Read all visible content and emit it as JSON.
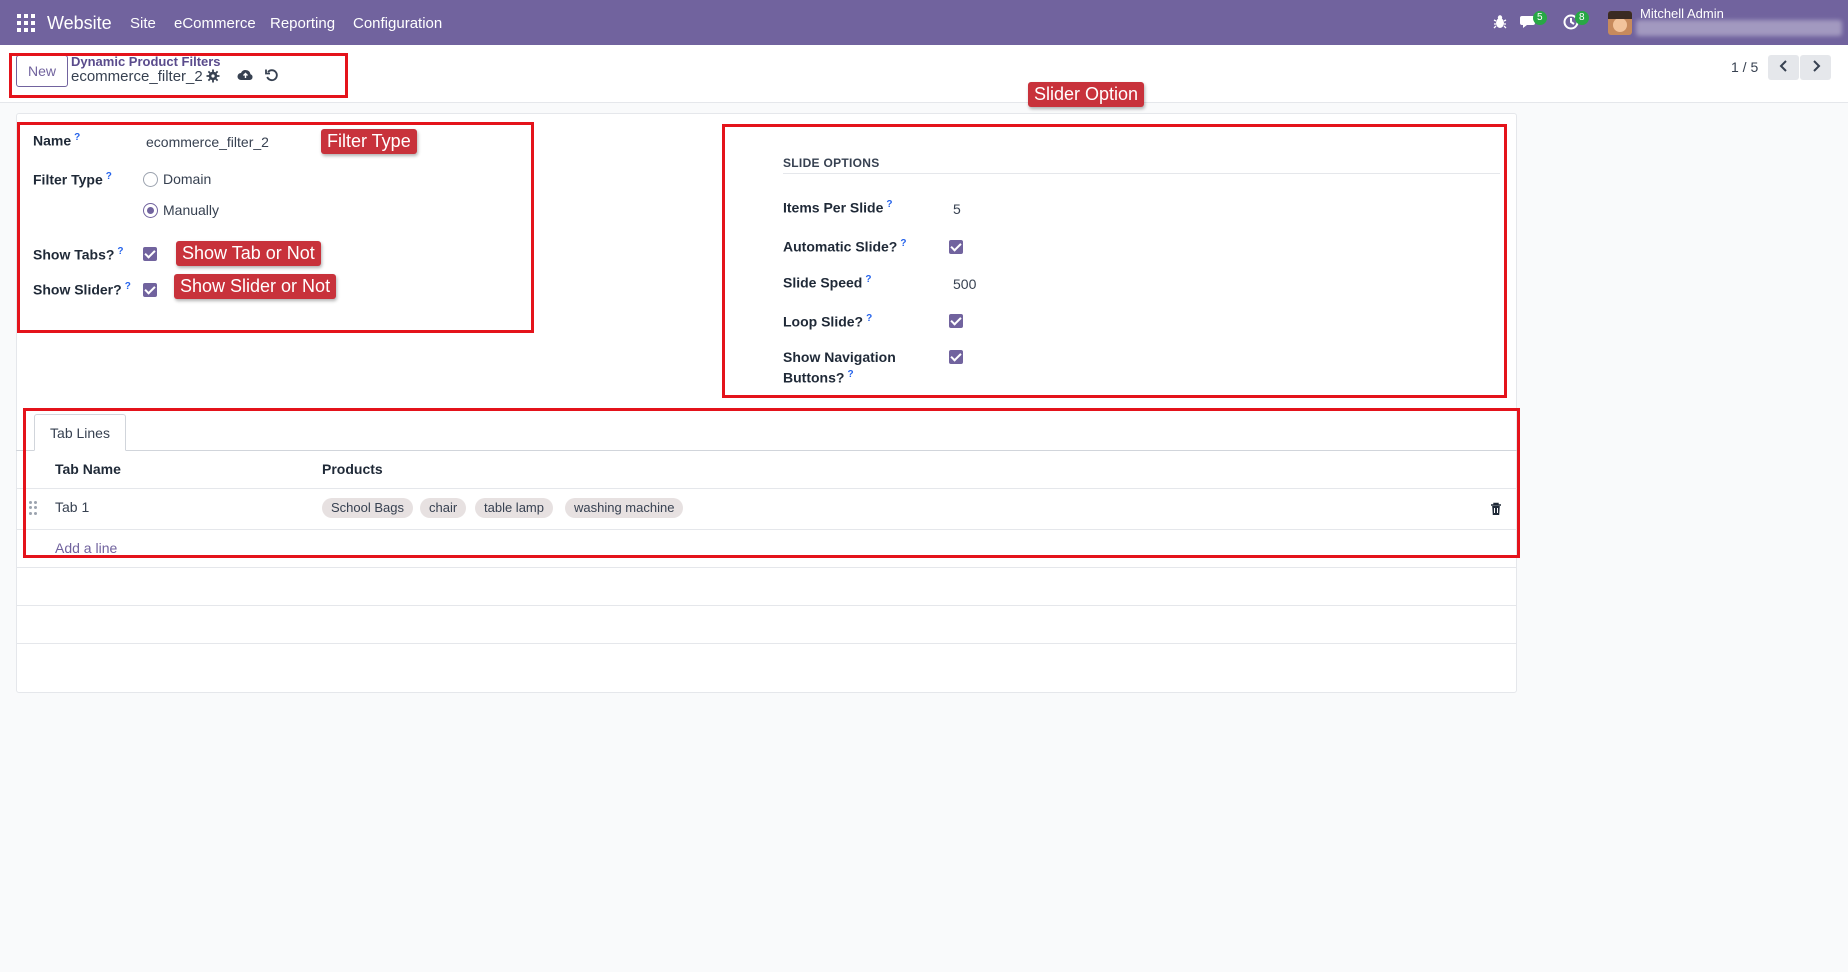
{
  "navbar": {
    "app_name": "Website",
    "menu": [
      "Site",
      "eCommerce",
      "Reporting",
      "Configuration"
    ],
    "messages_count": "5",
    "activities_count": "8",
    "user_name": "Mitchell Admin"
  },
  "control_panel": {
    "new_label": "New",
    "breadcrumb_parent": "Dynamic Product Filters",
    "breadcrumb_current": "ecommerce_filter_2",
    "pager": "1 / 5"
  },
  "form": {
    "name_label": "Name",
    "name_value": "ecommerce_filter_2",
    "filter_type_label": "Filter Type",
    "filter_type_options": [
      "Domain",
      "Manually"
    ],
    "filter_type_selected": "Manually",
    "show_tabs_label": "Show Tabs?",
    "show_tabs": true,
    "show_slider_label": "Show Slider?",
    "show_slider": true
  },
  "slide_options": {
    "title": "SLIDE OPTIONS",
    "items_per_slide_label": "Items Per Slide",
    "items_per_slide": "5",
    "automatic_slide_label": "Automatic Slide?",
    "automatic_slide": true,
    "slide_speed_label": "Slide Speed",
    "slide_speed": "500",
    "loop_slide_label": "Loop Slide?",
    "loop_slide": true,
    "show_nav_label_1": "Show Navigation",
    "show_nav_label_2": "Buttons?",
    "show_nav": true
  },
  "tab_lines": {
    "tab_label": "Tab Lines",
    "col_tab_name": "Tab Name",
    "col_products": "Products",
    "rows": [
      {
        "tab_name": "Tab 1",
        "products": [
          "School Bags",
          "chair",
          "table lamp",
          "washing machine"
        ]
      }
    ],
    "add_line": "Add a line"
  },
  "annotations": {
    "filter_type": "Filter Type",
    "show_tab": "Show Tab or Not",
    "show_slider": "Show Slider or Not",
    "slider_option": "Slider Option"
  },
  "help_mark": "?",
  "colors": {
    "navbar": "#71639e",
    "primary": "#71639e",
    "annotation_border": "#e4131b",
    "annotation_tag": "#c8323b",
    "tag_bg": "#e7e1e1"
  }
}
